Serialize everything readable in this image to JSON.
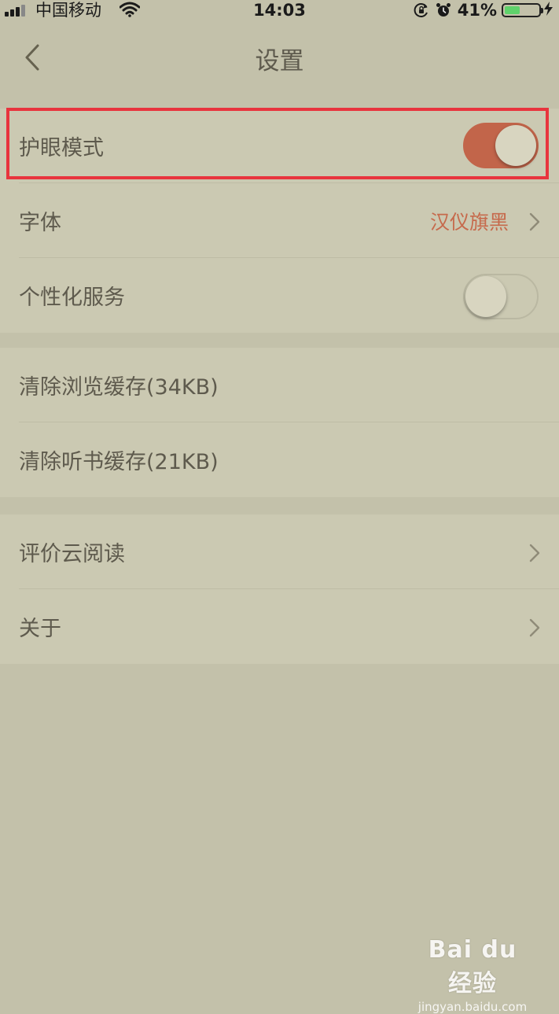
{
  "status_bar": {
    "carrier": "中国移动",
    "time": "14:03",
    "battery_percent_label": "41%",
    "battery_level": 0.41,
    "battery_color": "#5fd26b",
    "icons": [
      "signal-icon",
      "wifi-icon",
      "rotation-lock-icon",
      "alarm-clock-icon",
      "battery-icon",
      "charging-bolt-icon"
    ]
  },
  "nav": {
    "title": "设置",
    "back_icon": "chevron-left-icon"
  },
  "settings": {
    "eye_protection": {
      "label": "护眼模式",
      "enabled": true
    },
    "font": {
      "label": "字体",
      "value": "汉仪旗黑"
    },
    "personalized_service": {
      "label": "个性化服务",
      "enabled": false
    },
    "clear_browse_cache": {
      "label": "清除浏览缓存(34KB)"
    },
    "clear_audio_cache": {
      "label": "清除听书缓存(21KB)"
    },
    "rate_app": {
      "label": "评价云阅读"
    },
    "about": {
      "label": "关于"
    }
  },
  "colors": {
    "background": "#c3c1aa",
    "group_background": "#cbc9b2",
    "accent": "#c2654a",
    "font_value": "#c66a4c",
    "highlight_border": "#e8343d"
  },
  "watermark": {
    "logo": "Bai du 经验",
    "url": "jingyan.baidu.com"
  }
}
